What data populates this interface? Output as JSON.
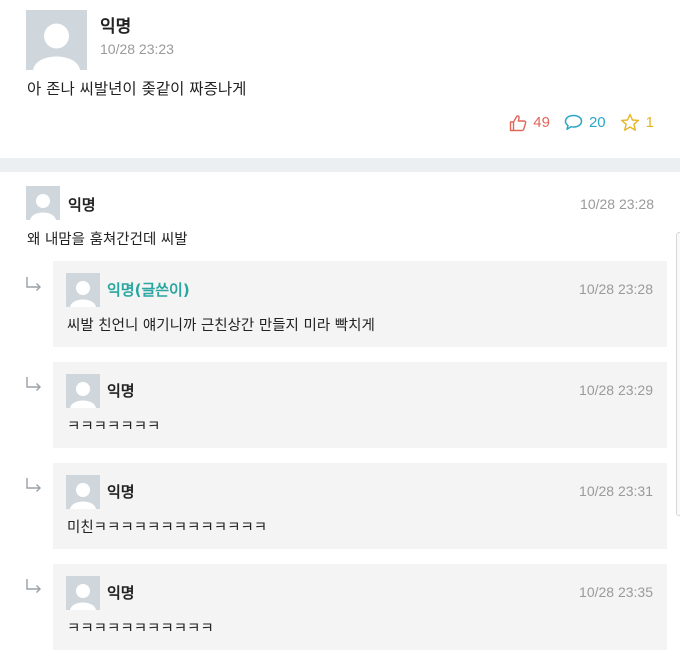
{
  "post": {
    "author": "익명",
    "time": "10/28 23:23",
    "body": "아 존나 씨발년이 좆같이 짜증나게",
    "likes": "49",
    "comments": "20",
    "scraps": "1"
  },
  "comments": [
    {
      "author": "익명",
      "time": "10/28 23:28",
      "text": "왜 내맘을 훔쳐간건데 씨발"
    }
  ],
  "replies": [
    {
      "author": "익명(글쓴이)",
      "is_writer": true,
      "time": "10/28 23:28",
      "text": "씨발 친언니 얘기니까 근친상간 만들지 미라 빡치게"
    },
    {
      "author": "익명",
      "is_writer": false,
      "time": "10/28 23:29",
      "text": "ㅋㅋㅋㅋㅋㅋㅋ"
    },
    {
      "author": "익명",
      "is_writer": false,
      "time": "10/28 23:31",
      "text": "미친ㅋㅋㅋㅋㅋㅋㅋㅋㅋㅋㅋㅋㅋ"
    },
    {
      "author": "익명",
      "is_writer": false,
      "time": "10/28 23:35",
      "text": "ㅋㅋㅋㅋㅋㅋㅋㅋㅋㅋㅋ"
    }
  ],
  "icons": {
    "like": "thumbs-up-icon",
    "comment": "speech-bubble-icon",
    "scrap": "star-icon",
    "reply": "reply-arrow-icon",
    "avatar": "default-avatar-icon"
  },
  "colors": {
    "like": "#e0665a",
    "comment": "#2aa6c6",
    "scrap": "#e6b425",
    "writer": "#2aa6a0",
    "avatar_bg": "#cfd6dc"
  }
}
